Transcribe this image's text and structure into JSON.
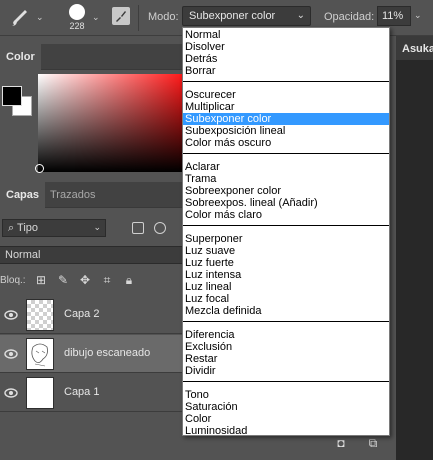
{
  "options_bar": {
    "brush_size": "228",
    "mode_label": "Modo:",
    "mode_value": "Subexponer color",
    "opacity_label": "Opacidad:",
    "opacity_value": "11%"
  },
  "document_tab": {
    "title": "Asuka"
  },
  "color_panel": {
    "tab_label": "Color",
    "foreground": "#000000",
    "background": "#ffffff"
  },
  "layers_panel": {
    "tabs": [
      "Capas",
      "Trazados"
    ],
    "filter_value": "Tipo",
    "blend_mode": "Normal",
    "lock_label": "Bloq.:",
    "layers": [
      {
        "name": "Capa 2",
        "visible": true,
        "selected": false
      },
      {
        "name": "dibujo escaneado",
        "visible": true,
        "selected": true
      },
      {
        "name": "Capa 1",
        "visible": true,
        "selected": false
      }
    ]
  },
  "mode_dropdown": {
    "selected": "Subexponer color",
    "groups": [
      [
        "Normal",
        "Disolver",
        "Detrás",
        "Borrar"
      ],
      [
        "Oscurecer",
        "Multiplicar",
        "Subexponer color",
        "Subexposición lineal",
        "Color más oscuro"
      ],
      [
        "Aclarar",
        "Trama",
        "Sobreexponer color",
        "Sobreexpos. lineal (Añadir)",
        "Color más claro"
      ],
      [
        "Superponer",
        "Luz suave",
        "Luz fuerte",
        "Luz intensa",
        "Luz lineal",
        "Luz focal",
        "Mezcla definida"
      ],
      [
        "Diferencia",
        "Exclusión",
        "Restar",
        "Dividir"
      ],
      [
        "Tono",
        "Saturación",
        "Color",
        "Luminosidad"
      ]
    ]
  },
  "colors": {
    "accent": "#3399ff",
    "panel": "#535353",
    "dark": "#3c3c3c"
  }
}
